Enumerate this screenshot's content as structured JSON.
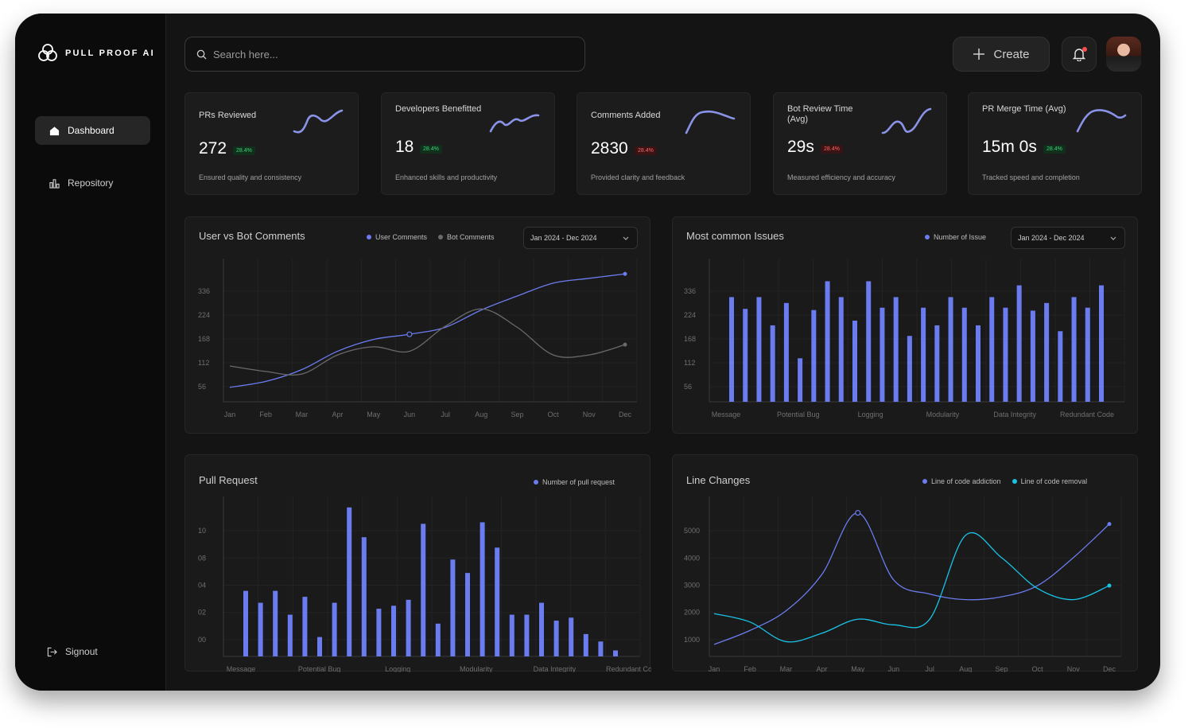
{
  "app": {
    "brand": "PULL PROOF AI"
  },
  "sidebar": {
    "items": [
      {
        "label": "Dashboard",
        "icon": "home-icon"
      },
      {
        "label": "Repository",
        "icon": "bar-chart-icon"
      }
    ],
    "signout_label": "Signout"
  },
  "search": {
    "placeholder": "Search here..."
  },
  "header": {
    "create_label": "Create"
  },
  "colors": {
    "accent": "#6b7cf0",
    "cyan": "#19c3e6",
    "grey_line": "#6a6a6a",
    "notification": "#ff4d4d"
  },
  "stats": [
    {
      "title": "PRs Reviewed",
      "value": "272",
      "badge": "28.4%",
      "trend": "up",
      "desc": "Ensured quality and consistency"
    },
    {
      "title": "Developers Benefitted",
      "value": "18",
      "badge": "28.4%",
      "trend": "up",
      "desc": "Enhanced skills and productivity"
    },
    {
      "title": "Comments Added",
      "value": "2830",
      "badge": "28.4%",
      "trend": "down",
      "desc": "Provided clarity and feedback"
    },
    {
      "title": "Bot Review Time (Avg)",
      "value": "29s",
      "badge": "28.4%",
      "trend": "down",
      "desc": "Measured efficiency and accuracy"
    },
    {
      "title": "PR Merge Time (Avg)",
      "value": "15m 0s",
      "badge": "28.4%",
      "trend": "up",
      "desc": "Tracked speed and completion"
    }
  ],
  "chart_data": [
    {
      "id": "user-vs-bot",
      "type": "line",
      "title": "User vs Bot Comments",
      "date_range": "Jan 2024 - Dec 2024",
      "categories": [
        "Jan",
        "Feb",
        "Mar",
        "Apr",
        "May",
        "Jun",
        "Jul",
        "Aug",
        "Sep",
        "Oct",
        "Nov",
        "Dec"
      ],
      "y_ticks": [
        "56",
        "112",
        "168",
        "224",
        "336"
      ],
      "series": [
        {
          "name": "User Comments",
          "color": "#6b7cf0",
          "values": [
            52,
            68,
            100,
            150,
            182,
            196,
            215,
            262,
            300,
            335,
            348,
            360
          ]
        },
        {
          "name": "Bot Comments",
          "color": "#6a6a6a",
          "values": [
            110,
            95,
            88,
            140,
            162,
            150,
            218,
            265,
            215,
            140,
            140,
            168
          ]
        }
      ]
    },
    {
      "id": "most-common-issues",
      "type": "bar",
      "title": "Most common Issues",
      "date_range": "Jan 2024 - Dec 2024",
      "categories": [
        "Message",
        "Potential Bug",
        "Logging",
        "Modularity",
        "Data Integrity",
        "Redundant Code"
      ],
      "y_ticks": [
        "56",
        "112",
        "168",
        "224",
        "336"
      ],
      "series": [
        {
          "name": "Number of Issue",
          "color": "#6b7cf0",
          "values": [
            178,
            158,
            178,
            130,
            168,
            74,
            156,
            205,
            178,
            138,
            205,
            160,
            178,
            112,
            160,
            130,
            178,
            160,
            130,
            178,
            160,
            198,
            155,
            168,
            120,
            178,
            160,
            198
          ]
        }
      ]
    },
    {
      "id": "pull-request",
      "type": "bar",
      "title": "Pull Request",
      "categories": [
        "Message",
        "Potential Bug",
        "Logging",
        "Modularity",
        "Data Integrity",
        "Redundant Code"
      ],
      "y_ticks": [
        "00",
        "02",
        "04",
        "08",
        "10"
      ],
      "series": [
        {
          "name": "Number of pull request",
          "color": "#6b7cf0",
          "values": [
            4.4,
            3.6,
            4.4,
            2.8,
            4.0,
            1.3,
            3.6,
            10,
            8.0,
            3.2,
            3.4,
            3.8,
            8.9,
            2.2,
            6.5,
            5.6,
            9.0,
            7.3,
            2.8,
            2.8,
            3.6,
            2.4,
            2.6,
            1.5,
            1.0,
            0.4
          ]
        }
      ]
    },
    {
      "id": "line-changes",
      "type": "line",
      "title": "Line Changes",
      "categories": [
        "Jan",
        "Feb",
        "Mar",
        "Apr",
        "May",
        "Jun",
        "Jul",
        "Aug",
        "Sep",
        "Oct",
        "Nov",
        "Dec"
      ],
      "y_ticks": [
        "1000",
        "2000",
        "3000",
        "4000",
        "5000"
      ],
      "series": [
        {
          "name": "Line of code addiction",
          "color": "#6b7cf0",
          "values": [
            900,
            1400,
            2100,
            3400,
            5600,
            3200,
            2700,
            2500,
            2600,
            3000,
            4000,
            5200
          ]
        },
        {
          "name": "Line of code removal",
          "color": "#19c3e6",
          "values": [
            2000,
            1700,
            1000,
            1300,
            1800,
            1600,
            1800,
            4800,
            4000,
            2900,
            2500,
            3000
          ]
        }
      ]
    }
  ]
}
